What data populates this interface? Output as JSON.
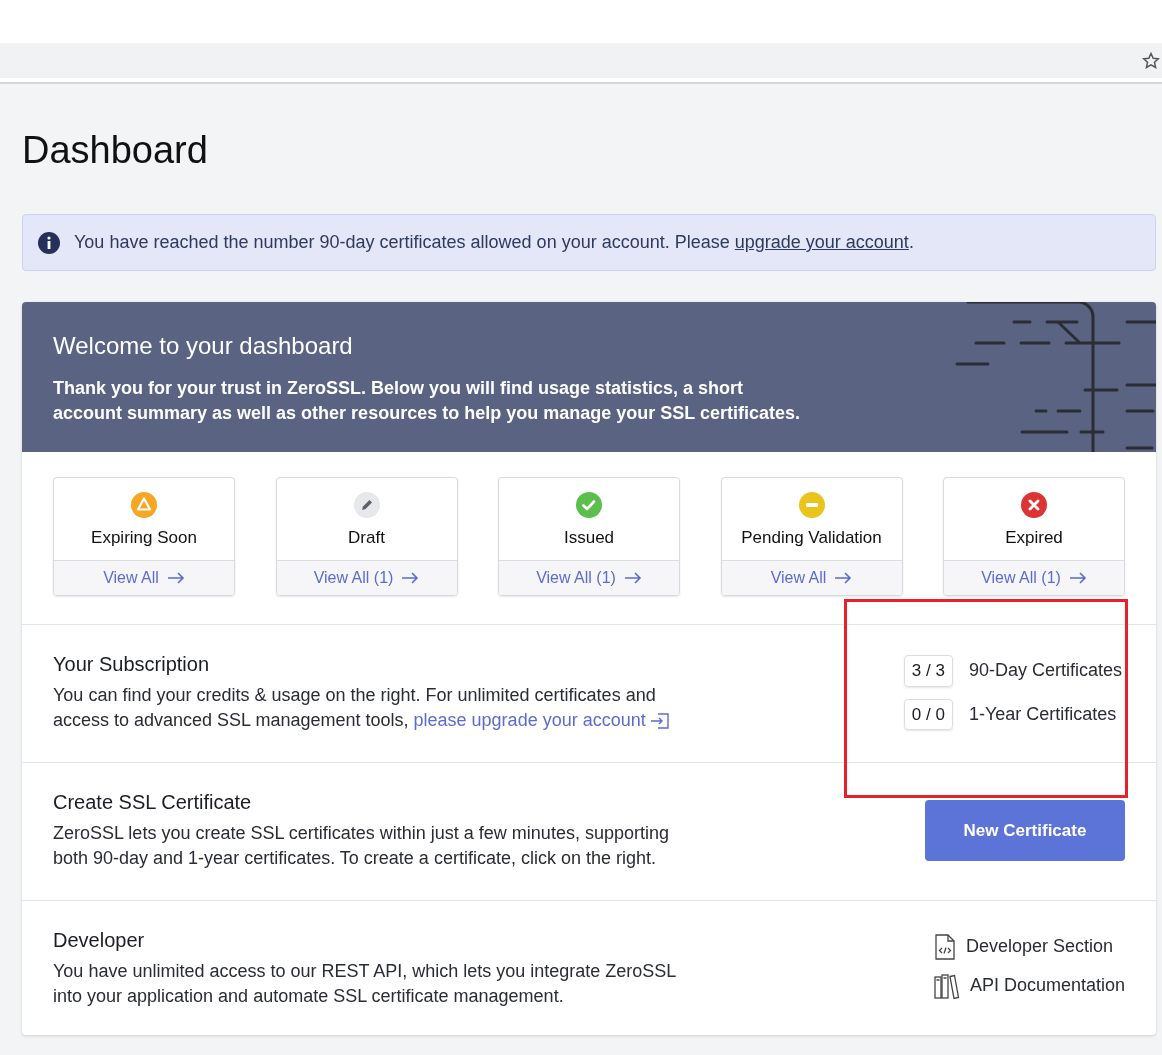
{
  "page": {
    "title": "Dashboard"
  },
  "alert": {
    "text": "You have reached the number 90-day certificates allowed on your account. Please ",
    "link": "upgrade your account",
    "end": "."
  },
  "welcome": {
    "title": "Welcome to your dashboard",
    "text": "Thank you for your trust in ZeroSSL. Below you will find usage statistics, a short account summary as well as other resources to help you manage your SSL certificates."
  },
  "status_cards": [
    {
      "kind": "warning",
      "label": "Expiring Soon",
      "link": "View All"
    },
    {
      "kind": "draft",
      "label": "Draft",
      "link": "View All (1)"
    },
    {
      "kind": "success",
      "label": "Issued",
      "link": "View All (1)"
    },
    {
      "kind": "pending",
      "label": "Pending Validation",
      "link": "View All"
    },
    {
      "kind": "error",
      "label": "Expired",
      "link": "View All (1)"
    }
  ],
  "subscription": {
    "title": "Your Subscription",
    "text": "You can find your credits & usage on the right. For unlimited certificates and access to advanced SSL management tools, ",
    "link": "please upgrade your account",
    "usage": [
      {
        "count": "3 / 3",
        "label": "90-Day Certificates"
      },
      {
        "count": "0 / 0",
        "label": "1-Year Certificates"
      }
    ]
  },
  "create": {
    "title": "Create SSL Certificate",
    "text": "ZeroSSL lets you create SSL certificates within just a few minutes, supporting both 90-day and 1-year certificates. To create a certificate, click on the right.",
    "button": "New Certificate"
  },
  "developer": {
    "title": "Developer",
    "text": "You have unlimited access to our REST API, which lets you integrate ZeroSSL into your application and automate SSL certificate management.",
    "links": [
      {
        "kind": "code",
        "label": "Developer Section"
      },
      {
        "kind": "books",
        "label": "API Documentation"
      }
    ]
  }
}
